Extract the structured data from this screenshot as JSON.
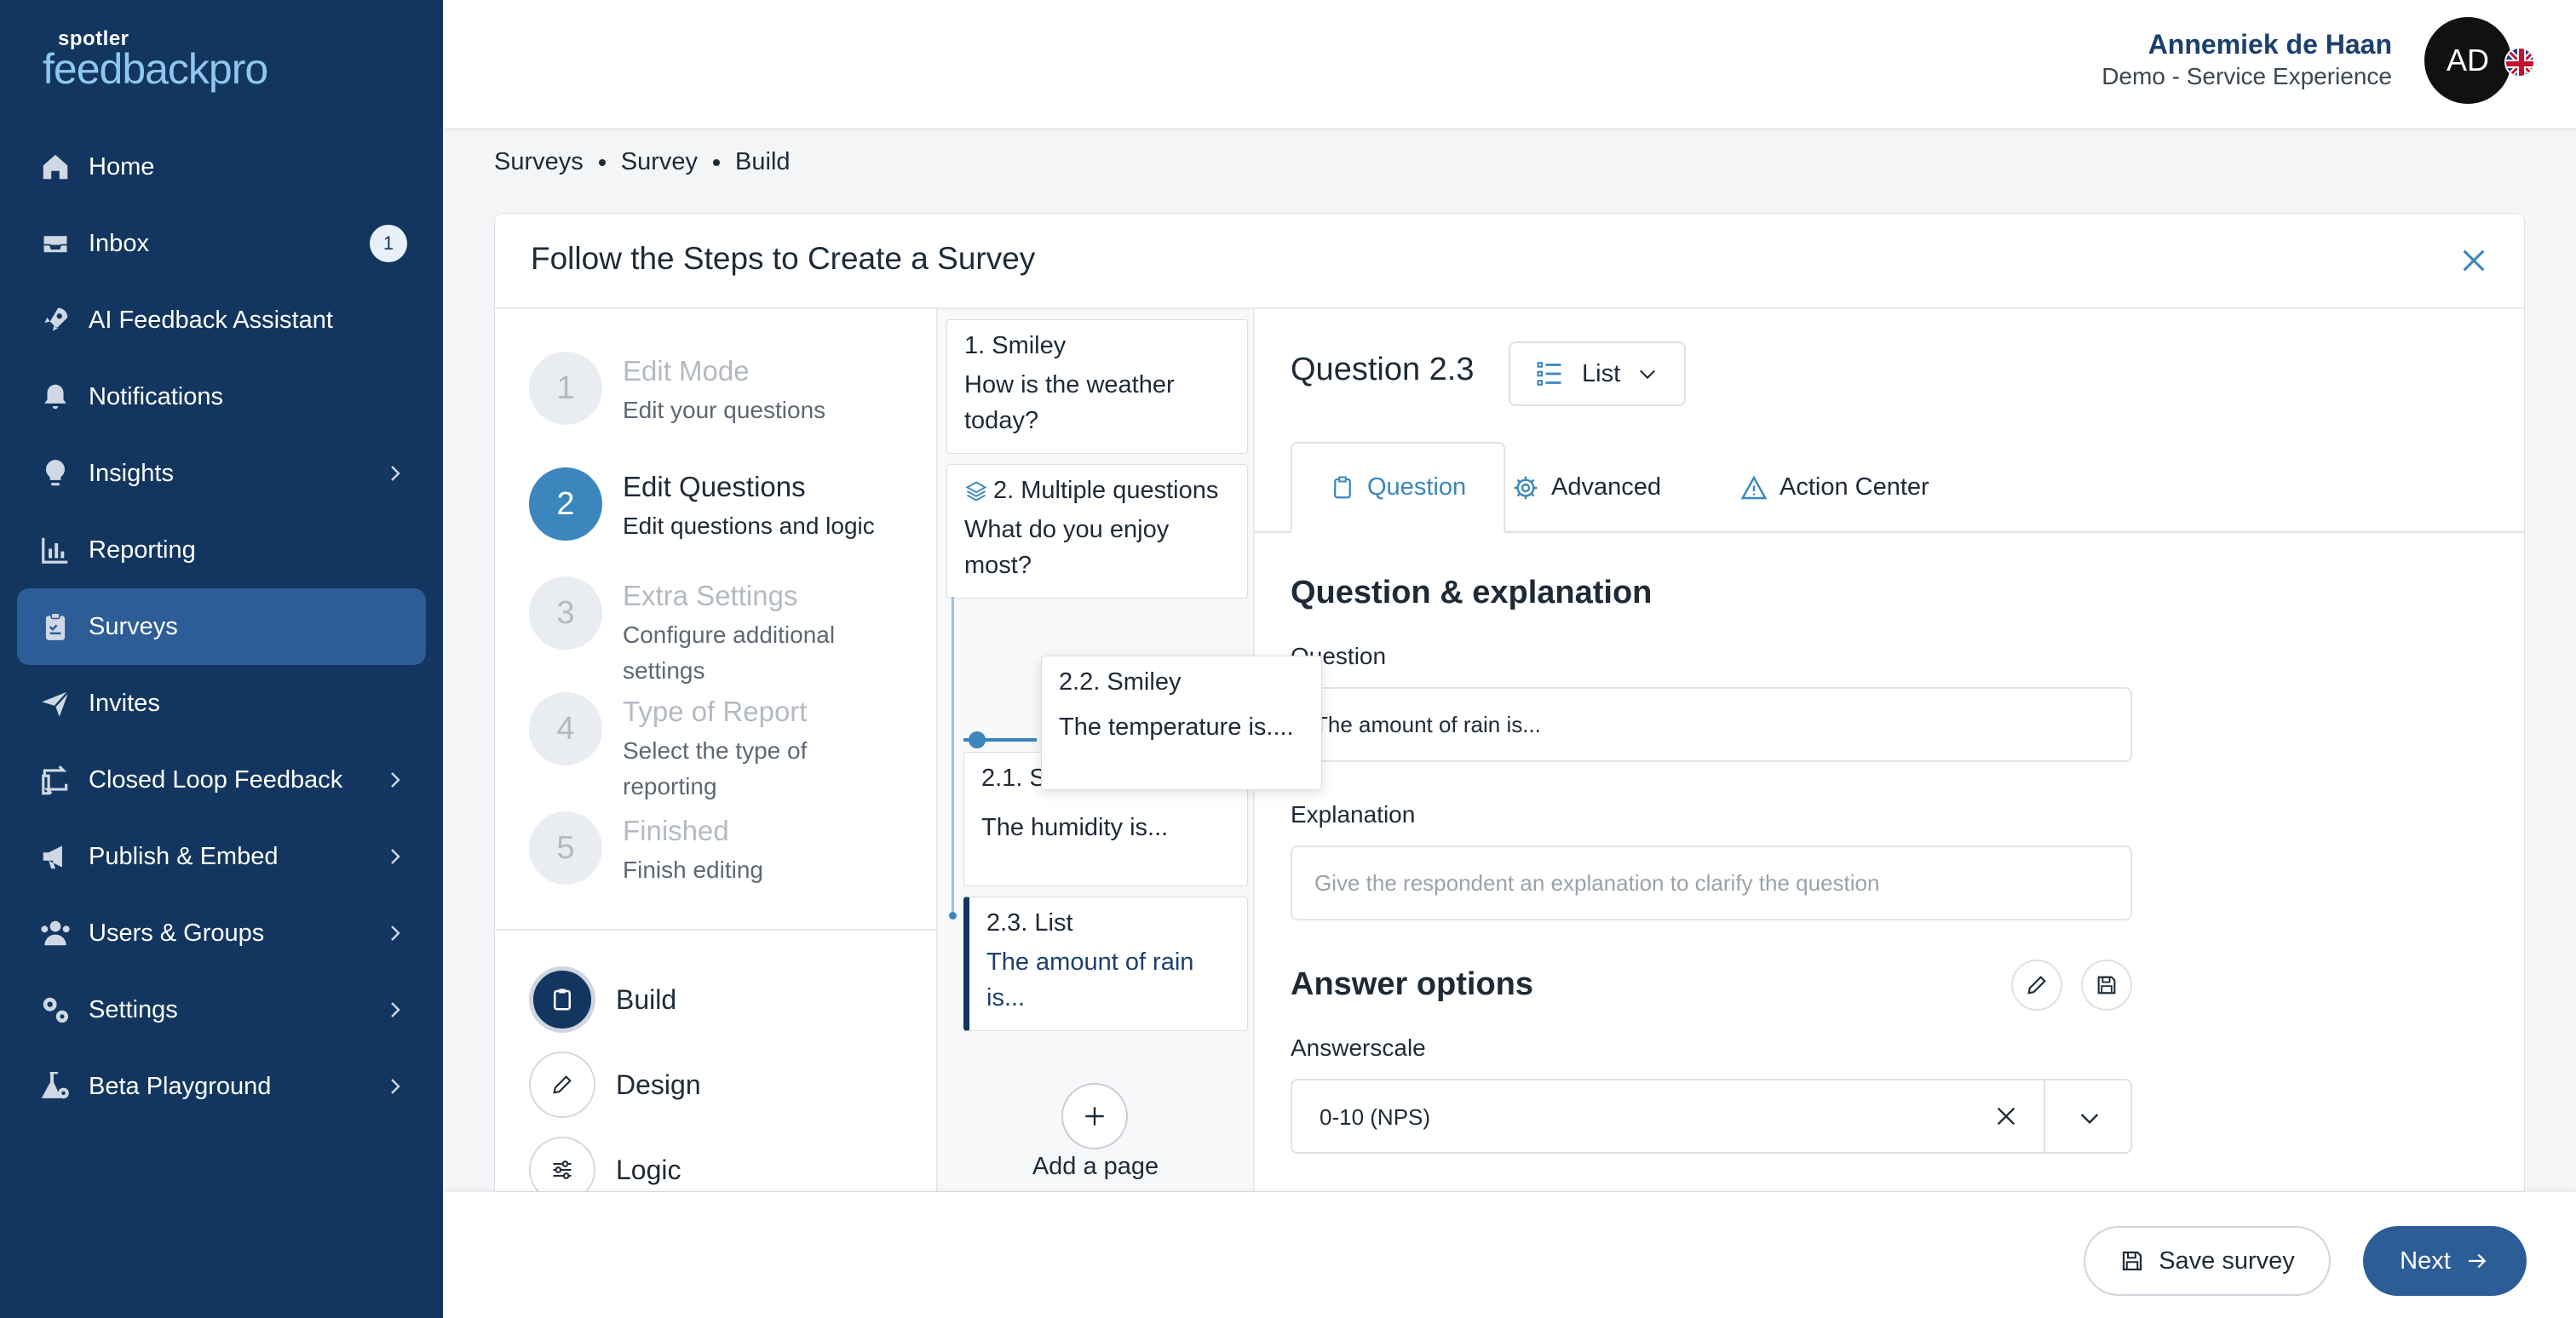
{
  "brand": {
    "small": "spotler",
    "big": "feedbackpro"
  },
  "sidebar": {
    "items": [
      {
        "label": "Home",
        "icon": "home-icon"
      },
      {
        "label": "Inbox",
        "icon": "inbox-icon",
        "badge": "1"
      },
      {
        "label": "AI Feedback Assistant",
        "icon": "rocket-icon"
      },
      {
        "label": "Notifications",
        "icon": "bell-icon"
      },
      {
        "label": "Insights",
        "icon": "lightbulb-icon"
      },
      {
        "label": "Reporting",
        "icon": "chart-icon"
      },
      {
        "label": "Surveys",
        "icon": "clipboard-icon",
        "active": true
      },
      {
        "label": "Invites",
        "icon": "paper-plane-icon"
      },
      {
        "label": "Closed Loop Feedback",
        "icon": "loop-icon"
      },
      {
        "label": "Publish & Embed",
        "icon": "megaphone-icon"
      },
      {
        "label": "Users & Groups",
        "icon": "users-icon"
      },
      {
        "label": "Settings",
        "icon": "gears-icon"
      },
      {
        "label": "Beta Playground",
        "icon": "flask-icon"
      }
    ]
  },
  "header": {
    "user_name": "Annemiek de Haan",
    "user_org": "Demo - Service Experience",
    "avatar_initials": "AD"
  },
  "breadcrumb": [
    "Surveys",
    "Survey",
    "Build"
  ],
  "panel": {
    "title": "Follow the Steps to Create a Survey",
    "steps": [
      {
        "num": "1",
        "title": "Edit Mode",
        "desc": "Edit your questions"
      },
      {
        "num": "2",
        "title": "Edit Questions",
        "desc": "Edit questions and logic"
      },
      {
        "num": "3",
        "title": "Extra Settings",
        "desc": "Configure additional settings"
      },
      {
        "num": "4",
        "title": "Type of Report",
        "desc": "Select the type of reporting"
      },
      {
        "num": "5",
        "title": "Finished",
        "desc": "Finish editing"
      }
    ],
    "modes": [
      "Build",
      "Design",
      "Logic"
    ]
  },
  "questions": {
    "q1": {
      "title": "1. Smiley",
      "body": "How is the weather today?"
    },
    "q2": {
      "title": "2. Multiple questions",
      "body": "What do you enjoy most?"
    },
    "q21": {
      "title": "2.1. S",
      "body": "The humidity is..."
    },
    "q23": {
      "title": "2.3. List",
      "body": "The amount of rain is..."
    },
    "drag": {
      "title": "2.2. Smiley",
      "body": "The temperature is...."
    },
    "add_page": "Add a page"
  },
  "editor": {
    "question_title": "Question 2.3",
    "type_label": "List",
    "tabs": [
      "Question",
      "Advanced",
      "Action Center"
    ],
    "section_title": "Question & explanation",
    "question_label": "Question",
    "question_value": "The amount of rain is...",
    "explanation_label": "Explanation",
    "explanation_placeholder": "Give the respondent an explanation to clarify the question",
    "answer_title": "Answer options",
    "answerscale_label": "Answerscale",
    "answerscale_value": "0-10 (NPS)"
  },
  "footer": {
    "save_label": "Save survey",
    "next_label": "Next"
  }
}
